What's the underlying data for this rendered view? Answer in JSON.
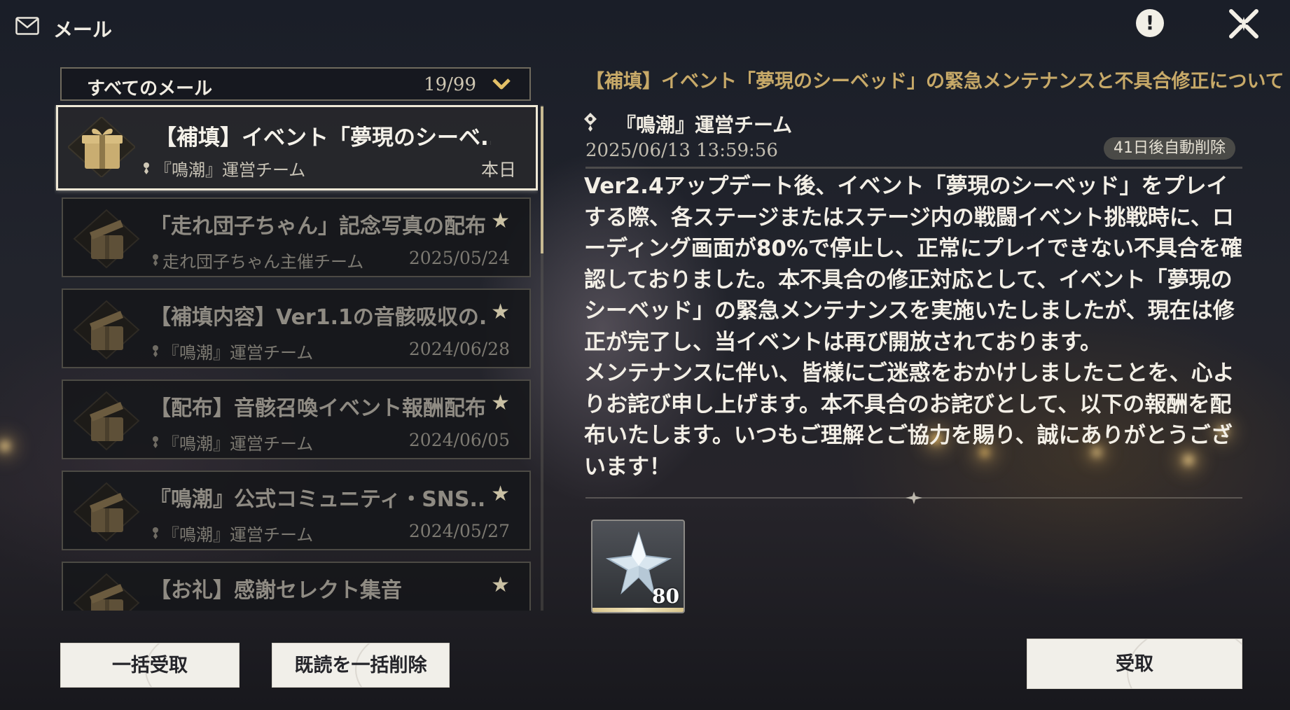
{
  "header": {
    "title": "メール",
    "info_glyph": "!",
    "icons": {
      "mail": "mail-icon",
      "info": "info-icon",
      "close": "close-icon"
    }
  },
  "filter": {
    "label": "すべてのメール",
    "count": "19/99"
  },
  "mails": [
    {
      "title": "【補填】イベント「夢現のシーベ...",
      "sender": "『鳴潮』運営チーム",
      "date": "本日",
      "selected": true,
      "icon": "gift-icon"
    },
    {
      "title": "「走れ団子ちゃん」記念写真の配布",
      "sender": "走れ団子ちゃん主催チーム",
      "date": "2025/05/24",
      "starred": true,
      "icon": "opened-gift-icon"
    },
    {
      "title": "【補填内容】Ver1.1の音骸吸収の...",
      "sender": "『鳴潮』運営チーム",
      "date": "2024/06/28",
      "starred": true,
      "icon": "opened-gift-icon"
    },
    {
      "title": "【配布】音骸召喚イベント報酬配布",
      "sender": "『鳴潮』運営チーム",
      "date": "2024/06/05",
      "starred": true,
      "icon": "opened-gift-icon"
    },
    {
      "title": "『鳴潮』公式コミュニティ・SNS...",
      "sender": "『鳴潮』運営チーム",
      "date": "2024/05/27",
      "starred": true,
      "icon": "opened-gift-icon"
    },
    {
      "title": "【お礼】感謝セレクト集音",
      "sender": "",
      "date": "",
      "starred": true,
      "icon": "opened-gift-icon"
    }
  ],
  "star_glyph": "★",
  "buttons": {
    "claim_all": "一括受取",
    "delete_read": "既読を一括削除",
    "claim": "受取"
  },
  "detail": {
    "title": "【補填】イベント「夢現のシーベッド」の緊急メンテナンスと不具合修正について",
    "sender": "『鳴潮』運営チーム",
    "date": "2025/06/13 13:59:56",
    "expire": "41日後自動削除",
    "body": "Ver2.4アップデート後、イベント「夢現のシーベッド」をプレイする際、各ステージまたはステージ内の戦闘イベント挑戦時に、ローディング画面が80%で停止し、正常にプレイできない不具合を確認しておりました。本不具合の修正対応として、イベント「夢現のシーベッド」の緊急メンテナンスを実施いたしましたが、現在は修正が完了し、当イベントは再び開放されております。\nメンテナンスに伴い、皆様にご迷惑をおかけしましたことを、心よりお詫び申し上げます。本不具合のお詫びとして、以下の報酬を配布いたします。いつもご理解とご協力を賜り、誠にありがとうございます！",
    "reward": {
      "icon": "astrite-crystal-icon",
      "quantity": "80"
    }
  },
  "colors": {
    "accent_gold": "#c7a968",
    "button_bg": "#f1efe9",
    "selected_border": "#eee8d6"
  }
}
